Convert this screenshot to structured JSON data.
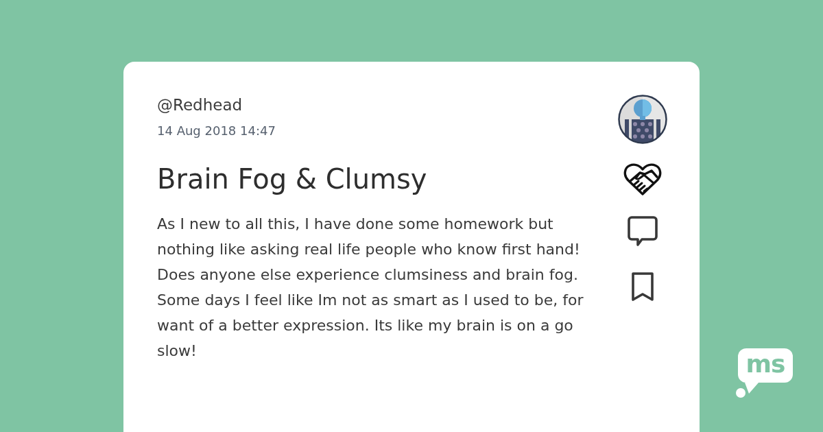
{
  "post": {
    "author": "@Redhead",
    "timestamp": "14 Aug 2018 14:47",
    "title": "Brain Fog & Clumsy",
    "body": "As I new to all this, I have done some homework but nothing like asking real life people who know first hand! Does anyone else experience clumsiness and brain fog. Some days I feel like Im not as smart as I used to be, for want of a better expression. Its like my brain is on a go slow!"
  },
  "logo": {
    "text": "ms"
  }
}
